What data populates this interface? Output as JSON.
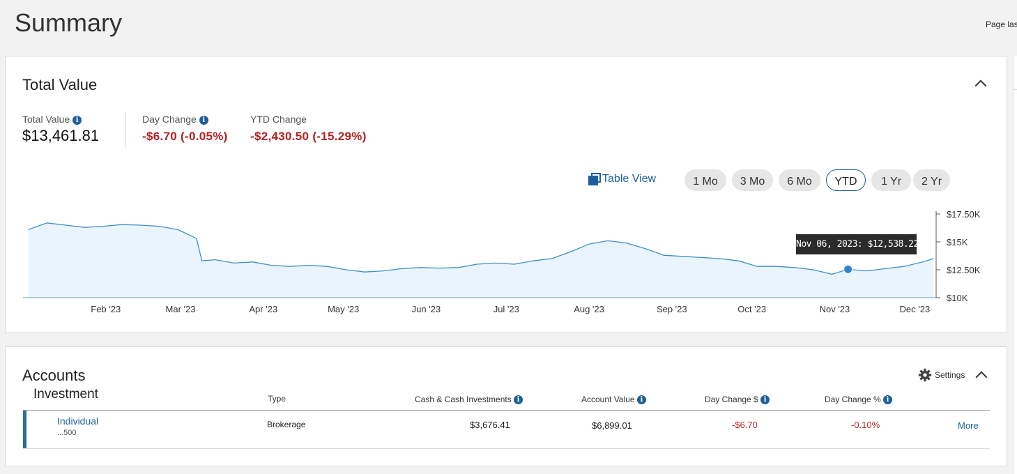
{
  "page": {
    "title": "Summary",
    "last_updated_label": "Page las"
  },
  "total_value_panel": {
    "title": "Total Value",
    "metrics": {
      "total_value_label": "Total Value",
      "total_value": "$13,461.81",
      "day_change_label": "Day Change",
      "day_change": "-$6.70 (-0.05%)",
      "ytd_change_label": "YTD Change",
      "ytd_change": "-$2,430.50 (-15.29%)"
    },
    "table_view_label": "Table View",
    "ranges": [
      "1 Mo",
      "3 Mo",
      "6 Mo",
      "YTD",
      "1 Yr",
      "2 Yr"
    ],
    "active_range": "YTD",
    "tooltip": "Nov 06, 2023: $12,538.22"
  },
  "chart_data": {
    "type": "area",
    "title": "",
    "xlabel": "",
    "ylabel": "",
    "x_tick_labels": [
      "Feb '23",
      "Mar '23",
      "Apr '23",
      "May '23",
      "Jun '23",
      "Jul '23",
      "Aug '23",
      "Sep '23",
      "Oct '23",
      "Nov '23",
      "Dec '23"
    ],
    "y_tick_labels": [
      "$17.50K",
      "$15K",
      "$12.50K",
      "$10K"
    ],
    "y_tick_values": [
      17500,
      15000,
      12500,
      10000
    ],
    "ylim": [
      10000,
      17500
    ],
    "x": [
      "2023-01-03",
      "2023-01-10",
      "2023-01-17",
      "2023-01-24",
      "2023-01-31",
      "2023-02-07",
      "2023-02-14",
      "2023-02-21",
      "2023-02-28",
      "2023-03-07",
      "2023-03-09",
      "2023-03-14",
      "2023-03-21",
      "2023-03-28",
      "2023-04-04",
      "2023-04-11",
      "2023-04-18",
      "2023-04-25",
      "2023-05-02",
      "2023-05-09",
      "2023-05-16",
      "2023-05-23",
      "2023-05-30",
      "2023-06-06",
      "2023-06-13",
      "2023-06-20",
      "2023-06-27",
      "2023-07-04",
      "2023-07-11",
      "2023-07-18",
      "2023-07-25",
      "2023-08-01",
      "2023-08-08",
      "2023-08-15",
      "2023-08-22",
      "2023-08-29",
      "2023-09-05",
      "2023-09-12",
      "2023-09-19",
      "2023-09-26",
      "2023-10-03",
      "2023-10-10",
      "2023-10-17",
      "2023-10-24",
      "2023-10-31",
      "2023-11-06",
      "2023-11-13",
      "2023-11-20",
      "2023-11-27",
      "2023-12-04",
      "2023-12-08"
    ],
    "values": [
      16100,
      16700,
      16500,
      16300,
      16400,
      16550,
      16500,
      16400,
      16100,
      15300,
      13300,
      13400,
      13100,
      13200,
      12900,
      12800,
      12900,
      12800,
      12500,
      12300,
      12400,
      12600,
      12700,
      12650,
      12700,
      13000,
      13100,
      13000,
      13300,
      13500,
      14100,
      14800,
      15100,
      14900,
      14400,
      13800,
      13700,
      13600,
      13500,
      13300,
      12800,
      12800,
      12700,
      12500,
      12100,
      12538,
      12400,
      12600,
      12800,
      13200,
      13500
    ],
    "highlight": {
      "x": "2023-11-06",
      "value": 12538.22
    },
    "line_color": "#3d8fc6",
    "fill_color": "#eaf4fc",
    "grid": false
  },
  "accounts_panel": {
    "title": "Accounts",
    "group": "Investment",
    "settings_label": "Settings",
    "columns": {
      "type": "Type",
      "cash": "Cash & Cash Investments",
      "account_value": "Account Value",
      "day_change_dollar": "Day Change $",
      "day_change_pct": "Day Change %"
    },
    "rows": [
      {
        "name": "Individual",
        "number": "...500",
        "type": "Brokerage",
        "cash": "$3,676.41",
        "account_value": "$6,899.01",
        "day_change_dollar": "-$6.70",
        "day_change_pct": "-0.10%",
        "more": "More"
      }
    ]
  },
  "colors": {
    "brand_blue": "#1d5f9b",
    "negative_red": "#b52020",
    "row_marker": "#2a6f9b"
  },
  "icons": {
    "info": "info-icon",
    "gear": "gear-icon",
    "table_view": "table-view-icon",
    "collapse": "chevron-up-icon"
  }
}
